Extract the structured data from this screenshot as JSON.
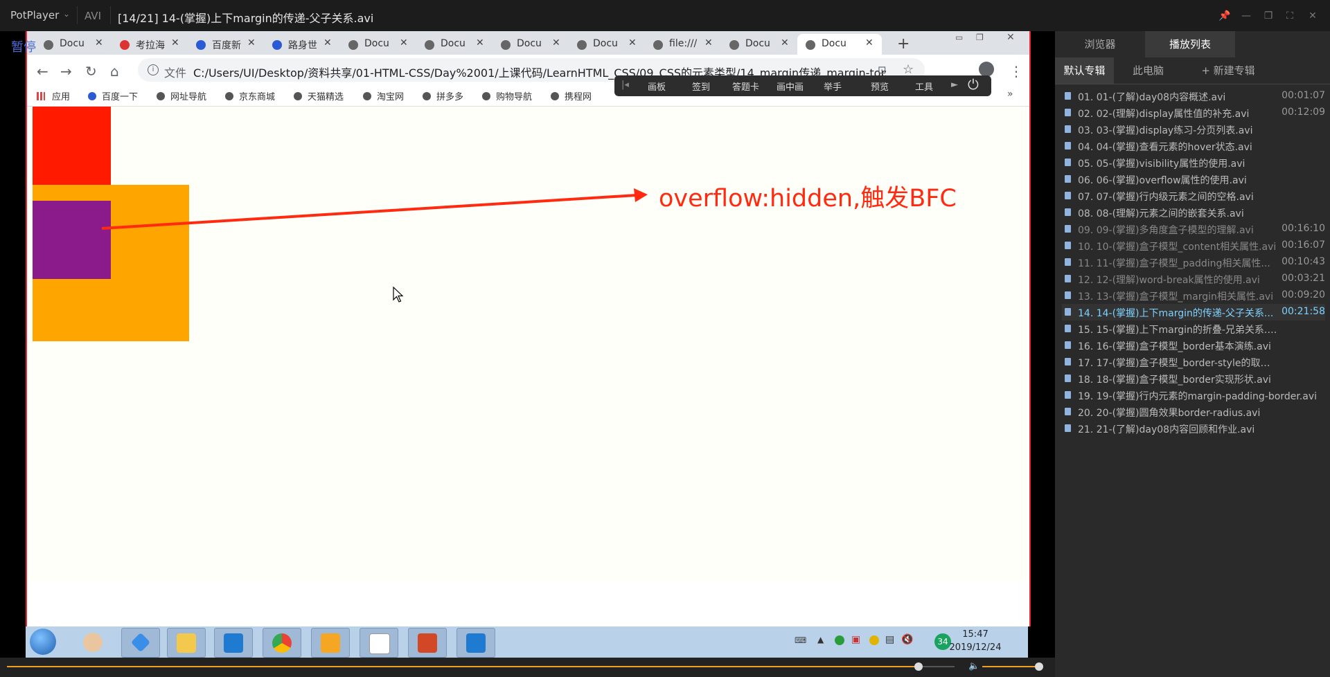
{
  "player": {
    "app_name": "PotPlayer",
    "format": "AVI",
    "title": "[14/21] 14-(掌握)上下margin的传递-父子关系.avi",
    "pause_label": "暂停"
  },
  "browser": {
    "tabs": [
      "Docu",
      "考拉海",
      "百度新",
      "路身世",
      "Docu",
      "Docu",
      "Docu",
      "Docu",
      "file:///",
      "Docu",
      "Docu"
    ],
    "file_label": "文件",
    "url": "C:/Users/UI/Desktop/资料共享/01-HTML-CSS/Day%2001/上课代码/LearnHTML_CSS/09_CSS的元素类型/14_margin传递_margin-top传递....",
    "bookmarks": [
      "应用",
      "百度一下",
      "网址导航",
      "京东商城",
      "天猫精选",
      "淘宝网",
      "拼多多",
      "购物导航",
      "携程网"
    ],
    "annotation": "overflow:hidden,触发BFC"
  },
  "overlay_toolbar": [
    "画板",
    "签到",
    "答题卡",
    "画中画",
    "举手",
    "预览",
    "工具"
  ],
  "taskbar": {
    "time": "15:47",
    "date": "2019/12/24",
    "badge": "34"
  },
  "panel": {
    "tabs": [
      "浏览器",
      "播放列表"
    ],
    "subtabs": [
      "默认专辑",
      "此电脑",
      "+ 新建专辑"
    ],
    "items": [
      {
        "name": "01. 01-(了解)day08内容概述.avi",
        "duration": "00:01:07"
      },
      {
        "name": "02. 02-(理解)display属性值的补充.avi",
        "duration": "00:12:09"
      },
      {
        "name": "03. 03-(掌握)display练习-分页列表.avi",
        "duration": ""
      },
      {
        "name": "04. 04-(掌握)查看元素的hover状态.avi",
        "duration": ""
      },
      {
        "name": "05. 05-(掌握)visibility属性的使用.avi",
        "duration": ""
      },
      {
        "name": "06. 06-(掌握)overflow属性的使用.avi",
        "duration": ""
      },
      {
        "name": "07. 07-(掌握)行内级元素之间的空格.avi",
        "duration": ""
      },
      {
        "name": "08. 08-(理解)元素之间的嵌套关系.avi",
        "duration": ""
      },
      {
        "name": "09. 09-(掌握)多角度盒子模型的理解.avi",
        "duration": "00:16:10"
      },
      {
        "name": "10. 10-(掌握)盒子模型_content相关属性.avi",
        "duration": "00:16:07"
      },
      {
        "name": "11. 11-(掌握)盒子模型_padding相关属性...",
        "duration": "00:10:43"
      },
      {
        "name": "12. 12-(理解)word-break属性的使用.avi",
        "duration": "00:03:21"
      },
      {
        "name": "13. 13-(掌握)盒子模型_margin相关属性.avi",
        "duration": "00:09:20"
      },
      {
        "name": "14. 14-(掌握)上下margin的传递-父子关系...",
        "duration": "00:21:58"
      },
      {
        "name": "15. 15-(掌握)上下margin的折叠-兄弟关系.avi",
        "duration": ""
      },
      {
        "name": "16. 16-(掌握)盒子模型_border基本演练.avi",
        "duration": ""
      },
      {
        "name": "17. 17-(掌握)盒子模型_border-style的取值.avi",
        "duration": ""
      },
      {
        "name": "18. 18-(掌握)盒子模型_border实现形状.avi",
        "duration": ""
      },
      {
        "name": "19. 19-(掌握)行内元素的margin-padding-border.avi",
        "duration": ""
      },
      {
        "name": "20. 20-(掌握)圆角效果border-radius.avi",
        "duration": ""
      },
      {
        "name": "21. 21-(了解)day08内容回顾和作业.avi",
        "duration": ""
      }
    ]
  },
  "colors": {
    "red_box": "#ff1a00",
    "orange_box": "#ffa500",
    "purple_box": "#8b1a8b",
    "annotation": "#ff2a10",
    "current_item": "#7ed2ff"
  }
}
